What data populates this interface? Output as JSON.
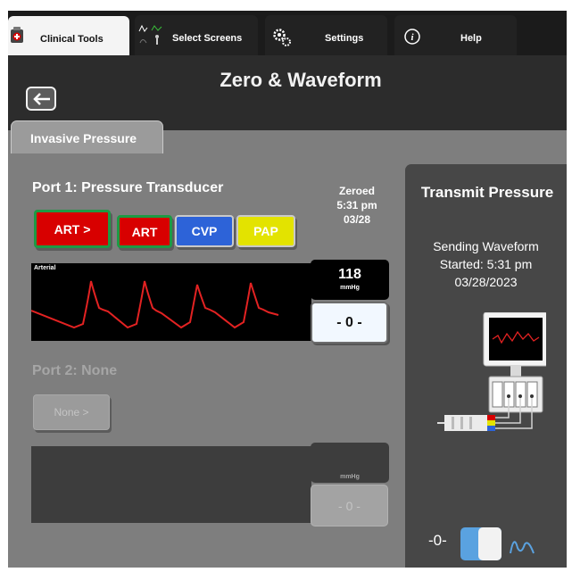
{
  "nav_tabs": [
    {
      "label": "Clinical Tools",
      "icon": "clinical-tools-icon"
    },
    {
      "label": "Select Screens",
      "icon": "select-screens-icon"
    },
    {
      "label": "Settings",
      "icon": "gear-icon"
    },
    {
      "label": "Help",
      "icon": "info-icon"
    }
  ],
  "header": {
    "title": "Zero & Waveform",
    "back_icon": "back-arrow-icon"
  },
  "subtab": {
    "label": "Invasive Pressure"
  },
  "port1": {
    "title": "Port 1: Pressure Transducer",
    "zeroed": {
      "label": "Zeroed",
      "time": "5:31 pm",
      "date": "03/28"
    },
    "buttons": [
      {
        "label": "ART >",
        "color": "#d80000"
      },
      {
        "label": "ART",
        "color": "#d80000"
      },
      {
        "label": "CVP",
        "color": "#2d63d8"
      },
      {
        "label": "PAP",
        "color": "#e3e300"
      }
    ],
    "waveform_label": "Arterial",
    "value": "118",
    "unit": "mmHg",
    "zero_button": "- 0 -"
  },
  "port2": {
    "title": "Port 2: None",
    "button": "None >",
    "value": "",
    "unit": "mmHg",
    "zero_button": "- 0 -"
  },
  "transmit": {
    "title": "Transmit Pressure",
    "status": "Sending Waveform",
    "started": "Started: 5:31 pm",
    "date": "03/28/2023",
    "zero_label": "-0-",
    "toggle_on": true,
    "wave_icon": "waveform-icon",
    "illustration": "monitor-transducer-icon"
  },
  "colors": {
    "accent_blue": "#5aa2e0",
    "waveform_red": "#e32222",
    "active_border": "#1d9a44"
  }
}
